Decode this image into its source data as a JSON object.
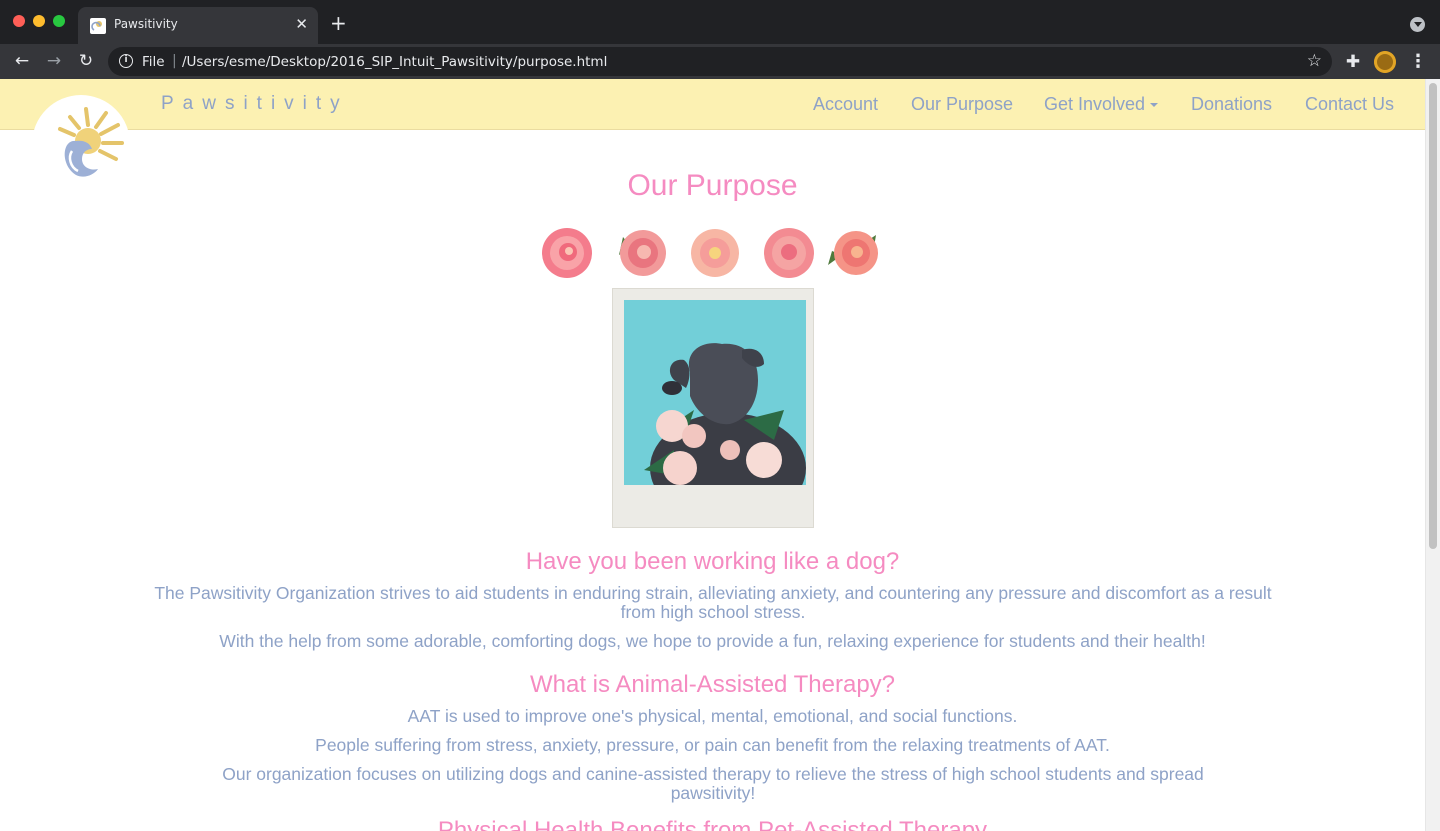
{
  "browser": {
    "tab_title": "Pawsitivity",
    "close_glyph": "✕",
    "new_tab_glyph": "+",
    "scheme_label": "File",
    "separator": "|",
    "url": "/Users/esme/Desktop/2016_SIP_Intuit_Pawsitivity/purpose.html",
    "info_glyph": "i",
    "star_glyph": "☆",
    "back_glyph": "←",
    "forward_glyph": "→",
    "reload_glyph": "↻",
    "extensions_glyph": "✚",
    "menu_glyph": "⋮",
    "colors": {
      "tabbar": "#202124",
      "toolbar": "#35363a"
    }
  },
  "site": {
    "brand": "Pawsitivity",
    "nav": {
      "account": "Account",
      "purpose": "Our Purpose",
      "get_involved": "Get Involved",
      "donations": "Donations",
      "contact": "Contact Us"
    },
    "colors": {
      "navbar_bg": "#fcf1b2",
      "link": "#8ea2c7",
      "heading": "#f58bc1"
    }
  },
  "page": {
    "title": "Our Purpose",
    "section1": {
      "heading": "Have you been working like a dog?",
      "p1": "The Pawsitivity Organization strives to aid students in enduring strain, alleviating anxiety, and countering any pressure and discomfort as a result from high school stress.",
      "p2": "With the help from some adorable, comforting dogs, we hope to provide a fun, relaxing experience for students and their health!"
    },
    "section2": {
      "heading": "What is Animal-Assisted Therapy?",
      "p1": "AAT is used to improve one's physical, mental, emotional, and social functions.",
      "p2": "People suffering from stress, anxiety, pressure, or pain can benefit from the relaxing treatments of AAT.",
      "p3": "Our organization focuses on utilizing dogs and canine-assisted therapy to relieve the stress of high school students and spread pawsitivity!"
    },
    "section3": {
      "heading": "Physical Health Benefits from Pet-Assisted Therapy"
    }
  }
}
